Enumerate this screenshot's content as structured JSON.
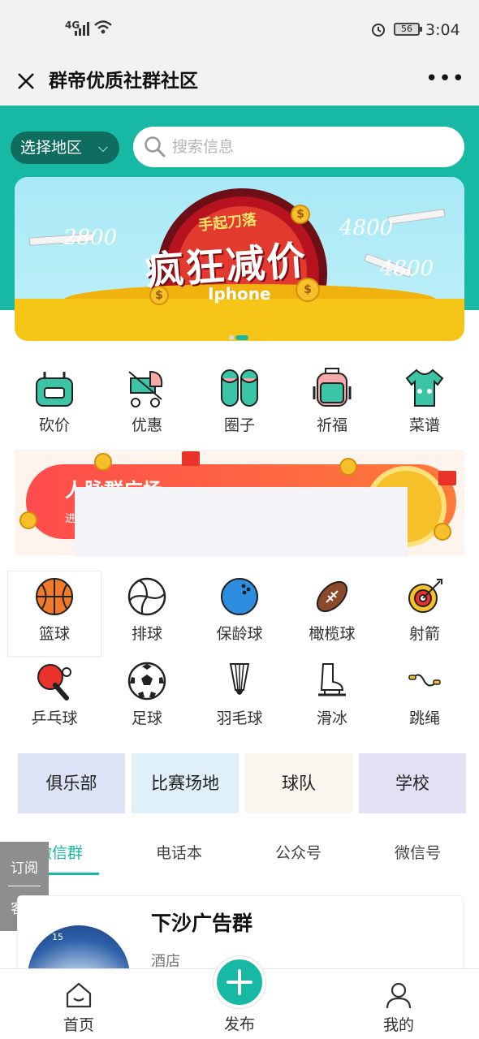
{
  "status_bar": {
    "network": "4G",
    "battery": "56",
    "time": "3:04"
  },
  "nav": {
    "title": "群帝优质社群社区"
  },
  "header": {
    "region_label": "选择地区",
    "search_placeholder": "搜索信息"
  },
  "banner": {
    "subtitle": "手起刀落",
    "headline": "疯狂减价",
    "product": "Iphone",
    "prices": [
      "2800",
      "4800",
      "4800"
    ],
    "carousel_active_index": 1,
    "carousel_count": 2
  },
  "categories": [
    {
      "label": "砍价",
      "icon": "bag-icon"
    },
    {
      "label": "优惠",
      "icon": "stroller-icon"
    },
    {
      "label": "圈子",
      "icon": "slippers-icon"
    },
    {
      "label": "祈福",
      "icon": "backpack-icon"
    },
    {
      "label": "菜谱",
      "icon": "baby-clothes-icon"
    }
  ],
  "promo": {
    "title": "人脉群广场",
    "subtitle": "进"
  },
  "sports": [
    {
      "label": "篮球",
      "icon": "basketball-icon"
    },
    {
      "label": "排球",
      "icon": "volleyball-icon"
    },
    {
      "label": "保龄球",
      "icon": "bowling-ball-icon"
    },
    {
      "label": "橄榄球",
      "icon": "rugby-ball-icon"
    },
    {
      "label": "射箭",
      "icon": "target-icon"
    },
    {
      "label": "乒乓球",
      "icon": "ping-pong-icon"
    },
    {
      "label": "足球",
      "icon": "soccer-ball-icon"
    },
    {
      "label": "羽毛球",
      "icon": "shuttlecock-icon"
    },
    {
      "label": "滑冰",
      "icon": "ice-skate-icon"
    },
    {
      "label": "跳绳",
      "icon": "jump-rope-icon"
    }
  ],
  "tags": [
    {
      "label": "俱乐部",
      "color": "#dde3f6"
    },
    {
      "label": "比赛场地",
      "color": "#dff0f8"
    },
    {
      "label": "球队",
      "color": "#faf6ee"
    },
    {
      "label": "学校",
      "color": "#e3e0f5"
    }
  ],
  "tabs": [
    "微信群",
    "电话本",
    "公众号",
    "微信号"
  ],
  "side_float": {
    "subscribe": "订阅",
    "service": "客服"
  },
  "listing": {
    "name": "下沙广告群",
    "category": "酒店",
    "thumb_text": "15"
  },
  "bottom_nav": {
    "home": "首页",
    "publish": "发布",
    "mine": "我的"
  },
  "colors": {
    "accent": "#18b9a4",
    "region_button": "#0f6d60"
  }
}
